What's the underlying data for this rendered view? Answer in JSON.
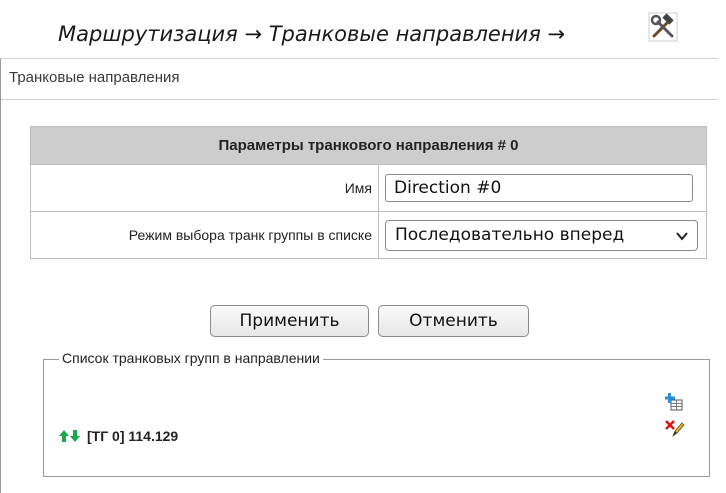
{
  "caption": {
    "text": "Маршрутизация → Транковые направления →",
    "icon": "hammer-wrench-icon"
  },
  "panel": {
    "title": "Транковые направления"
  },
  "params": {
    "title": "Параметры транкового направления # 0",
    "name_label": "Имя",
    "name_value": "Direction #0",
    "mode_label": "Режим выбора транк группы в списке",
    "mode_value": "Последовательно вперед"
  },
  "buttons": {
    "apply": "Применить",
    "cancel": "Отменить"
  },
  "groups": {
    "legend": "Список транковых групп в направлении",
    "add_icon": "add-table-icon",
    "delete_edit_icon": "delete-edit-icon",
    "items": [
      {
        "label": "[ТГ 0] 114.129",
        "icon": "up-down-arrows-icon"
      }
    ]
  },
  "colors": {
    "table_header_bg": "#cdcdcd",
    "arrow_green": "#1aa84a"
  }
}
